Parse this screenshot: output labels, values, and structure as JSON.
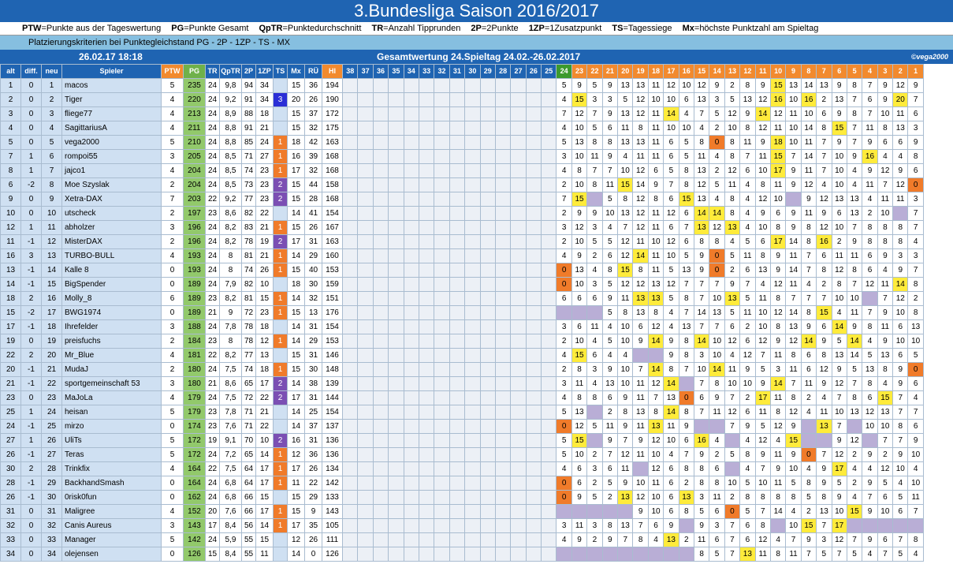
{
  "title": "3.Bundesliga Saison 2016/2017",
  "legend": [
    [
      "PTW",
      "Punkte aus der Tageswertung"
    ],
    [
      "PG",
      "Punkte Gesamt"
    ],
    [
      "QpTR",
      "Punktedurchschnitt"
    ],
    [
      "TR",
      "Anzahl Tipprunden"
    ],
    [
      "2P",
      "2Punkte"
    ],
    [
      "1ZP",
      "1Zusatzpunkt"
    ],
    [
      "TS",
      "Tagessiege"
    ],
    [
      "Mx",
      "höchste Punktzahl am Spieltag"
    ]
  ],
  "criteria": "Platzierungskriterien bei Punktegleichstand  PG - 2P - 1ZP - TS - MX",
  "date": "26.02.17 18:18",
  "gesamt": "Gesamtwertung 24.Spieltag 24.02.-26.02.2017",
  "copyright": "©vega2000",
  "headers": [
    "alt",
    "diff.",
    "neu",
    "Spieler",
    "PTW",
    "PG",
    "TR",
    "QpTR",
    "2P",
    "1ZP",
    "TS",
    "Mx",
    "RÜ",
    "HI"
  ],
  "matchdays": [
    "38",
    "37",
    "36",
    "35",
    "34",
    "33",
    "32",
    "31",
    "30",
    "29",
    "28",
    "27",
    "26",
    "25",
    "24",
    "23",
    "22",
    "21",
    "20",
    "19",
    "18",
    "17",
    "16",
    "15",
    "14",
    "13",
    "12",
    "11",
    "10",
    "9",
    "8",
    "7",
    "6",
    "5",
    "4",
    "3",
    "2",
    "1"
  ],
  "rows": [
    [
      "1",
      "0",
      "1",
      "macos",
      "5",
      "235",
      "24",
      "9,8",
      "94",
      "34",
      "",
      "15",
      "36",
      "194"
    ],
    [
      "2",
      "0",
      "2",
      "Tiger",
      "4",
      "220",
      "24",
      "9,2",
      "91",
      "34",
      "3",
      "20",
      "26",
      "190"
    ],
    [
      "3",
      "0",
      "3",
      "fliege77",
      "4",
      "213",
      "24",
      "8,9",
      "88",
      "18",
      "",
      "15",
      "37",
      "172"
    ],
    [
      "4",
      "0",
      "4",
      "SagittariusA",
      "4",
      "211",
      "24",
      "8,8",
      "91",
      "21",
      "",
      "15",
      "32",
      "175"
    ],
    [
      "5",
      "0",
      "5",
      "vega2000",
      "5",
      "210",
      "24",
      "8,8",
      "85",
      "24",
      "1",
      "18",
      "42",
      "163"
    ],
    [
      "7",
      "1",
      "6",
      "rompoi55",
      "3",
      "205",
      "24",
      "8,5",
      "71",
      "27",
      "1",
      "16",
      "39",
      "168"
    ],
    [
      "8",
      "1",
      "7",
      "jajco1",
      "4",
      "204",
      "24",
      "8,5",
      "74",
      "23",
      "1",
      "17",
      "32",
      "168"
    ],
    [
      "6",
      "-2",
      "8",
      "Moe Szyslak",
      "2",
      "204",
      "24",
      "8,5",
      "73",
      "23",
      "2",
      "15",
      "44",
      "158"
    ],
    [
      "9",
      "0",
      "9",
      "Xetra-DAX",
      "7",
      "203",
      "22",
      "9,2",
      "77",
      "23",
      "2",
      "15",
      "28",
      "168"
    ],
    [
      "10",
      "0",
      "10",
      "utscheck",
      "2",
      "197",
      "23",
      "8,6",
      "82",
      "22",
      "",
      "14",
      "41",
      "154"
    ],
    [
      "12",
      "1",
      "11",
      "abholzer",
      "3",
      "196",
      "24",
      "8,2",
      "83",
      "21",
      "1",
      "15",
      "26",
      "167"
    ],
    [
      "11",
      "-1",
      "12",
      "MisterDAX",
      "2",
      "196",
      "24",
      "8,2",
      "78",
      "19",
      "2",
      "17",
      "31",
      "163"
    ],
    [
      "16",
      "3",
      "13",
      "TURBO-BULL",
      "4",
      "193",
      "24",
      "8",
      "81",
      "21",
      "1",
      "14",
      "29",
      "160"
    ],
    [
      "13",
      "-1",
      "14",
      "Kalle 8",
      "0",
      "193",
      "24",
      "8",
      "74",
      "26",
      "1",
      "15",
      "40",
      "153"
    ],
    [
      "14",
      "-1",
      "15",
      "BigSpender",
      "0",
      "189",
      "24",
      "7,9",
      "82",
      "10",
      "",
      "18",
      "30",
      "159"
    ],
    [
      "18",
      "2",
      "16",
      "Molly_8",
      "6",
      "189",
      "23",
      "8,2",
      "81",
      "15",
      "1",
      "14",
      "32",
      "151"
    ],
    [
      "15",
      "-2",
      "17",
      "BWG1974",
      "0",
      "189",
      "21",
      "9",
      "72",
      "23",
      "1",
      "15",
      "13",
      "176"
    ],
    [
      "17",
      "-1",
      "18",
      "Ihrefelder",
      "3",
      "188",
      "24",
      "7,8",
      "78",
      "18",
      "",
      "14",
      "31",
      "154"
    ],
    [
      "19",
      "0",
      "19",
      "preisfuchs",
      "2",
      "184",
      "23",
      "8",
      "78",
      "12",
      "1",
      "14",
      "29",
      "153"
    ],
    [
      "22",
      "2",
      "20",
      "Mr_Blue",
      "4",
      "181",
      "22",
      "8,2",
      "77",
      "13",
      "",
      "15",
      "31",
      "146"
    ],
    [
      "20",
      "-1",
      "21",
      "MudaJ",
      "2",
      "180",
      "24",
      "7,5",
      "74",
      "18",
      "1",
      "15",
      "30",
      "148"
    ],
    [
      "21",
      "-1",
      "22",
      "sportgemeinschaft 53",
      "3",
      "180",
      "21",
      "8,6",
      "65",
      "17",
      "2",
      "14",
      "38",
      "139"
    ],
    [
      "23",
      "0",
      "23",
      "MaJoLa",
      "4",
      "179",
      "24",
      "7,5",
      "72",
      "22",
      "2",
      "17",
      "31",
      "144"
    ],
    [
      "25",
      "1",
      "24",
      "heisan",
      "5",
      "179",
      "23",
      "7,8",
      "71",
      "21",
      "",
      "14",
      "25",
      "154"
    ],
    [
      "24",
      "-1",
      "25",
      "mirzo",
      "0",
      "174",
      "23",
      "7,6",
      "71",
      "22",
      "",
      "14",
      "37",
      "137"
    ],
    [
      "27",
      "1",
      "26",
      "UliTs",
      "5",
      "172",
      "19",
      "9,1",
      "70",
      "10",
      "2",
      "16",
      "31",
      "136"
    ],
    [
      "26",
      "-1",
      "27",
      "Teras",
      "5",
      "172",
      "24",
      "7,2",
      "65",
      "14",
      "1",
      "12",
      "36",
      "136"
    ],
    [
      "30",
      "2",
      "28",
      "Trinkfix",
      "4",
      "164",
      "22",
      "7,5",
      "64",
      "17",
      "1",
      "17",
      "26",
      "134"
    ],
    [
      "28",
      "-1",
      "29",
      "BackhandSmash",
      "0",
      "164",
      "24",
      "6,8",
      "64",
      "17",
      "1",
      "11",
      "22",
      "142"
    ],
    [
      "26",
      "-1",
      "30",
      "0risk0fun",
      "0",
      "162",
      "24",
      "6,8",
      "66",
      "15",
      "",
      "15",
      "29",
      "133"
    ],
    [
      "31",
      "0",
      "31",
      "Maligree",
      "4",
      "152",
      "20",
      "7,6",
      "66",
      "17",
      "1",
      "15",
      "9",
      "143"
    ],
    [
      "32",
      "0",
      "32",
      "Canis Aureus",
      "3",
      "143",
      "17",
      "8,4",
      "56",
      "14",
      "1",
      "17",
      "35",
      "105"
    ],
    [
      "33",
      "0",
      "33",
      "Manager",
      "5",
      "142",
      "24",
      "5,9",
      "55",
      "15",
      "",
      "12",
      "26",
      "111"
    ],
    [
      "34",
      "0",
      "34",
      "olejensen",
      "0",
      "126",
      "15",
      "8,4",
      "55",
      "11",
      "",
      "14",
      "0",
      "126"
    ]
  ],
  "scores": [
    [
      "5",
      "9",
      "5",
      "9",
      "13",
      "13",
      "11",
      "12",
      "10",
      "12",
      "9",
      "2",
      "8",
      "9",
      "15",
      "13",
      "14",
      "13",
      "9",
      "8",
      "7",
      "9",
      "12",
      "9"
    ],
    [
      "4",
      "15",
      "3",
      "3",
      "5",
      "12",
      "10",
      "10",
      "6",
      "13",
      "3",
      "5",
      "13",
      "12",
      "16",
      "10",
      "16",
      "2",
      "13",
      "7",
      "6",
      "9",
      "20",
      "7"
    ],
    [
      "7",
      "12",
      "7",
      "9",
      "13",
      "12",
      "11",
      "14",
      "4",
      "7",
      "5",
      "12",
      "9",
      "14",
      "12",
      "11",
      "10",
      "6",
      "9",
      "8",
      "7",
      "10",
      "11",
      "6"
    ],
    [
      "4",
      "10",
      "5",
      "6",
      "11",
      "8",
      "11",
      "10",
      "10",
      "4",
      "2",
      "10",
      "8",
      "12",
      "11",
      "10",
      "14",
      "8",
      "15",
      "7",
      "11",
      "8",
      "13",
      "3"
    ],
    [
      "5",
      "13",
      "8",
      "8",
      "13",
      "13",
      "11",
      "6",
      "5",
      "8",
      "0",
      "8",
      "11",
      "9",
      "18",
      "10",
      "11",
      "7",
      "9",
      "7",
      "9",
      "6",
      "6",
      "9"
    ],
    [
      "3",
      "10",
      "11",
      "9",
      "4",
      "11",
      "11",
      "6",
      "5",
      "11",
      "4",
      "8",
      "7",
      "11",
      "15",
      "7",
      "14",
      "7",
      "10",
      "9",
      "16",
      "4",
      "4",
      "8"
    ],
    [
      "4",
      "8",
      "7",
      "7",
      "10",
      "12",
      "6",
      "5",
      "8",
      "13",
      "2",
      "12",
      "6",
      "10",
      "17",
      "9",
      "11",
      "7",
      "10",
      "4",
      "9",
      "12",
      "9",
      "6"
    ],
    [
      "2",
      "10",
      "8",
      "11",
      "15",
      "14",
      "9",
      "7",
      "8",
      "12",
      "5",
      "11",
      "4",
      "8",
      "11",
      "9",
      "12",
      "4",
      "10",
      "4",
      "11",
      "7",
      "12",
      "0"
    ],
    [
      "7",
      "15",
      "",
      "5",
      "8",
      "12",
      "8",
      "6",
      "15",
      "13",
      "4",
      "8",
      "4",
      "12",
      "10",
      "",
      "9",
      "12",
      "13",
      "13",
      "4",
      "11",
      "11",
      "3"
    ],
    [
      "2",
      "9",
      "9",
      "10",
      "13",
      "12",
      "11",
      "12",
      "6",
      "14",
      "14",
      "8",
      "4",
      "9",
      "6",
      "9",
      "11",
      "9",
      "6",
      "13",
      "2",
      "10",
      "",
      "7"
    ],
    [
      "3",
      "12",
      "3",
      "4",
      "7",
      "12",
      "11",
      "6",
      "7",
      "13",
      "12",
      "13",
      "4",
      "10",
      "8",
      "9",
      "8",
      "12",
      "10",
      "7",
      "8",
      "8",
      "8",
      "7"
    ],
    [
      "2",
      "10",
      "5",
      "5",
      "12",
      "11",
      "10",
      "12",
      "6",
      "8",
      "8",
      "4",
      "5",
      "6",
      "17",
      "14",
      "8",
      "16",
      "2",
      "9",
      "8",
      "8",
      "8",
      "4"
    ],
    [
      "4",
      "9",
      "2",
      "6",
      "12",
      "14",
      "11",
      "10",
      "5",
      "9",
      "0",
      "5",
      "11",
      "8",
      "9",
      "11",
      "7",
      "6",
      "11",
      "11",
      "6",
      "9",
      "3",
      "3"
    ],
    [
      "0",
      "13",
      "4",
      "8",
      "15",
      "8",
      "11",
      "5",
      "13",
      "9",
      "0",
      "2",
      "6",
      "13",
      "9",
      "14",
      "7",
      "8",
      "12",
      "8",
      "6",
      "4",
      "9",
      "7"
    ],
    [
      "0",
      "10",
      "3",
      "5",
      "12",
      "12",
      "13",
      "12",
      "7",
      "7",
      "7",
      "9",
      "7",
      "4",
      "12",
      "11",
      "4",
      "2",
      "8",
      "7",
      "12",
      "11",
      "14",
      "8"
    ],
    [
      "6",
      "6",
      "6",
      "9",
      "11",
      "13",
      "13",
      "5",
      "8",
      "7",
      "10",
      "13",
      "5",
      "11",
      "8",
      "7",
      "7",
      "7",
      "10",
      "10",
      "",
      "7",
      "12",
      "2"
    ],
    [
      "",
      "",
      "",
      "5",
      "8",
      "13",
      "8",
      "4",
      "7",
      "14",
      "13",
      "5",
      "11",
      "10",
      "12",
      "14",
      "8",
      "15",
      "4",
      "11",
      "7",
      "9",
      "10",
      "8"
    ],
    [
      "3",
      "6",
      "11",
      "4",
      "10",
      "6",
      "12",
      "4",
      "13",
      "7",
      "7",
      "6",
      "2",
      "10",
      "8",
      "13",
      "9",
      "6",
      "14",
      "9",
      "8",
      "11",
      "6",
      "13"
    ],
    [
      "2",
      "10",
      "4",
      "5",
      "10",
      "9",
      "14",
      "9",
      "8",
      "14",
      "10",
      "12",
      "6",
      "12",
      "9",
      "12",
      "14",
      "9",
      "5",
      "14",
      "4",
      "9",
      "10",
      "10"
    ],
    [
      "4",
      "15",
      "6",
      "4",
      "4",
      "",
      "",
      "9",
      "8",
      "3",
      "10",
      "4",
      "12",
      "7",
      "11",
      "8",
      "6",
      "8",
      "13",
      "14",
      "5",
      "13",
      "6",
      "5"
    ],
    [
      "2",
      "8",
      "3",
      "9",
      "10",
      "7",
      "14",
      "8",
      "7",
      "10",
      "14",
      "11",
      "9",
      "5",
      "3",
      "11",
      "6",
      "12",
      "9",
      "5",
      "13",
      "8",
      "9",
      "0"
    ],
    [
      "3",
      "11",
      "4",
      "13",
      "10",
      "11",
      "12",
      "14",
      "",
      "7",
      "8",
      "10",
      "10",
      "9",
      "14",
      "7",
      "11",
      "9",
      "12",
      "7",
      "8",
      "4",
      "9",
      "6"
    ],
    [
      "4",
      "8",
      "8",
      "6",
      "9",
      "11",
      "7",
      "13",
      "0",
      "6",
      "9",
      "7",
      "2",
      "17",
      "11",
      "8",
      "2",
      "4",
      "7",
      "8",
      "6",
      "15",
      "7",
      "4"
    ],
    [
      "5",
      "13",
      "",
      "2",
      "8",
      "13",
      "8",
      "14",
      "8",
      "7",
      "11",
      "12",
      "6",
      "11",
      "8",
      "12",
      "4",
      "11",
      "10",
      "13",
      "12",
      "13",
      "7",
      "7"
    ],
    [
      "0",
      "12",
      "5",
      "11",
      "9",
      "11",
      "13",
      "11",
      "9",
      "",
      "",
      "7",
      "9",
      "5",
      "12",
      "9",
      "",
      "13",
      "7",
      "",
      "10",
      "10",
      "8",
      "6"
    ],
    [
      "5",
      "15",
      "",
      "9",
      "7",
      "9",
      "12",
      "10",
      "6",
      "16",
      "4",
      "",
      "4",
      "12",
      "4",
      "15",
      "",
      "",
      "9",
      "12",
      "",
      "7",
      "7",
      "9"
    ],
    [
      "5",
      "10",
      "2",
      "7",
      "12",
      "11",
      "10",
      "4",
      "7",
      "9",
      "2",
      "5",
      "8",
      "9",
      "11",
      "9",
      "0",
      "7",
      "12",
      "2",
      "9",
      "2",
      "9",
      "10"
    ],
    [
      "4",
      "6",
      "3",
      "6",
      "11",
      "",
      "12",
      "6",
      "8",
      "8",
      "6",
      "",
      "4",
      "7",
      "9",
      "10",
      "4",
      "9",
      "17",
      "4",
      "4",
      "12",
      "10",
      "4"
    ],
    [
      "0",
      "6",
      "2",
      "5",
      "9",
      "10",
      "11",
      "6",
      "2",
      "8",
      "8",
      "10",
      "5",
      "10",
      "11",
      "5",
      "8",
      "9",
      "5",
      "2",
      "9",
      "5",
      "4",
      "10"
    ],
    [
      "0",
      "9",
      "5",
      "2",
      "13",
      "12",
      "10",
      "6",
      "13",
      "3",
      "11",
      "2",
      "8",
      "8",
      "8",
      "8",
      "5",
      "8",
      "9",
      "4",
      "7",
      "6",
      "5",
      "11"
    ],
    [
      "",
      "",
      "",
      "",
      "",
      "9",
      "10",
      "6",
      "8",
      "5",
      "6",
      "0",
      "5",
      "7",
      "14",
      "4",
      "2",
      "13",
      "10",
      "15",
      "9",
      "10",
      "6",
      "7"
    ],
    [
      "3",
      "11",
      "3",
      "8",
      "13",
      "7",
      "6",
      "9",
      "",
      "9",
      "3",
      "7",
      "6",
      "8",
      "",
      "10",
      "15",
      "7",
      "17",
      "",
      "",
      "",
      "",
      ""
    ],
    [
      "4",
      "9",
      "2",
      "9",
      "7",
      "8",
      "4",
      "13",
      "2",
      "11",
      "6",
      "7",
      "6",
      "12",
      "4",
      "7",
      "9",
      "3",
      "12",
      "7",
      "9",
      "6",
      "7",
      "8"
    ],
    [
      "",
      "",
      "",
      "",
      "",
      "",
      "",
      "",
      "",
      "8",
      "5",
      "7",
      "13",
      "11",
      "8",
      "11",
      "7",
      "5",
      "7",
      "5",
      "4",
      "7",
      "5",
      "4"
    ]
  ],
  "colors": {
    "header_blue": "#1f64b2",
    "orange": "#f28a2e",
    "green": "#6fb14a",
    "yellow": "#ffeb3b",
    "lavender": "#b9aed6"
  }
}
